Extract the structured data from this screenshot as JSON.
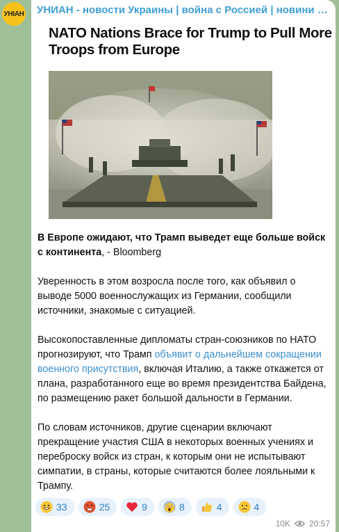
{
  "channel": {
    "avatar_text": "УНІАН",
    "name": "УНИАН - новости Украины | война с Россией | новини Україні…"
  },
  "post": {
    "headline": "NATO Nations Brace for Trump to Pull More Troops from Europe",
    "lead_bold": "В Европе ожидают, что Трамп выведет еще больше войск с континента",
    "lead_rest": ", - Bloomberg",
    "para2": "Уверенность в этом возросла после того, как объявил о выводе 5000 военнослужащих из Германии, сообщили источники, знакомые с ситуацией.",
    "para3_before": "Высокопоставленные дипломаты стран-союзников по НАТО прогнозируют, что Трамп ",
    "para3_link": "объявит о дальнейшем сокращении военного присутствия",
    "para3_after": ", включая Италию, а также откажется от плана, разработанного еще во время президентства Байдена, по размещению ракет большой дальности в Германии.",
    "para4": "По словам источников, другие сценарии включают прекращение участия США в некоторых военных учениях и переброску войск из стран, к которым они не испытывают симпатии, в страны, которые считаются более лояльными к Трампу."
  },
  "reactions": [
    {
      "icon": "grin-emoji-icon",
      "count": "33"
    },
    {
      "icon": "angry-face-emoji-icon",
      "count": "25"
    },
    {
      "icon": "heart-emoji-icon",
      "count": "9"
    },
    {
      "icon": "screaming-face-emoji-icon",
      "count": "8"
    },
    {
      "icon": "thumbs-up-emoji-icon",
      "count": "4"
    },
    {
      "icon": "confused-face-emoji-icon",
      "count": "4"
    }
  ],
  "meta": {
    "views": "10K",
    "time": "20:57"
  },
  "colors": {
    "accent": "#3f9fd6",
    "link": "#3a8fd0",
    "background": "#9fbf97",
    "avatar": "#f7c21a"
  }
}
